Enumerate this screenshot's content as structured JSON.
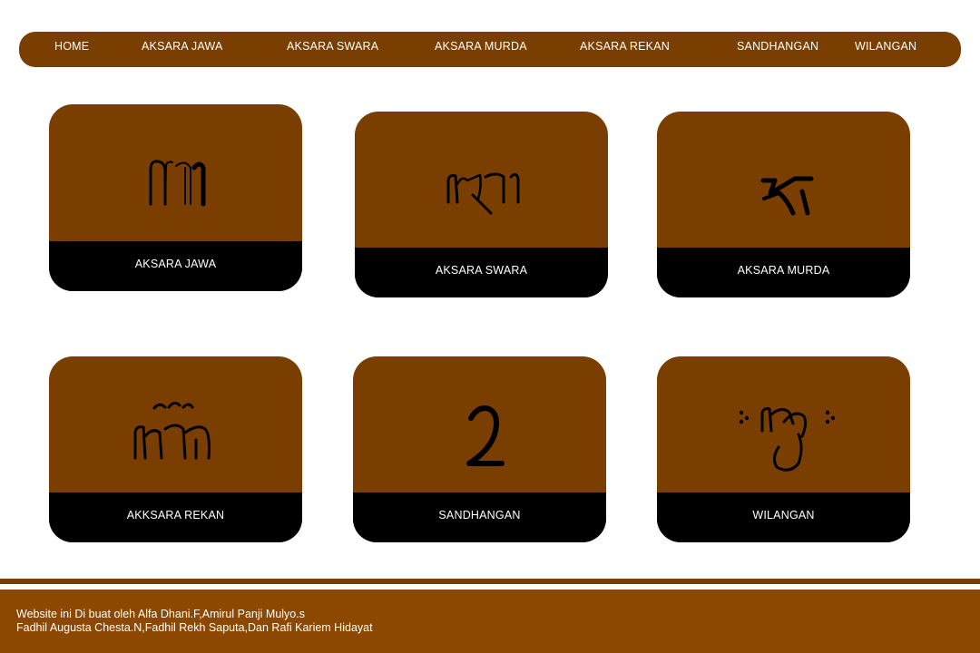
{
  "nav": {
    "items": [
      {
        "label": "HOME"
      },
      {
        "label": "AKSARA JAWA"
      },
      {
        "label": "AKSARA SWARA"
      },
      {
        "label": "AKSARA MURDA"
      },
      {
        "label": "AKSARA REKAN"
      },
      {
        "label": "SANDHANGAN"
      },
      {
        "label": "WILANGAN"
      }
    ]
  },
  "cards": [
    {
      "label": "AKSARA JAWA",
      "icon": "javanese-glyph-ha-icon"
    },
    {
      "label": "AKSARA SWARA",
      "icon": "javanese-glyph-swara-icon"
    },
    {
      "label": "AKSARA MURDA",
      "icon": "javanese-glyph-murda-icon"
    },
    {
      "label": "AKKSARA REKAN",
      "icon": "javanese-glyph-rekan-icon"
    },
    {
      "label": "SANDHANGAN",
      "icon": "javanese-glyph-sandhangan-icon"
    },
    {
      "label": "WILANGAN",
      "icon": "javanese-glyph-wilangan-icon"
    }
  ],
  "footer": {
    "line1": "Website ini Di buat oleh Alfa Dhani.F,Amirul Panji Mulyo.s",
    "line2": "Fadhil Augusta Chesta.N,Fadhil Rekh Saputa,Dan Rafi Kariem Hidayat"
  },
  "colors": {
    "brown": "#7a3f00",
    "footer_brown": "#8c4700",
    "label_bg": "#000000",
    "text": "#ffffff"
  }
}
